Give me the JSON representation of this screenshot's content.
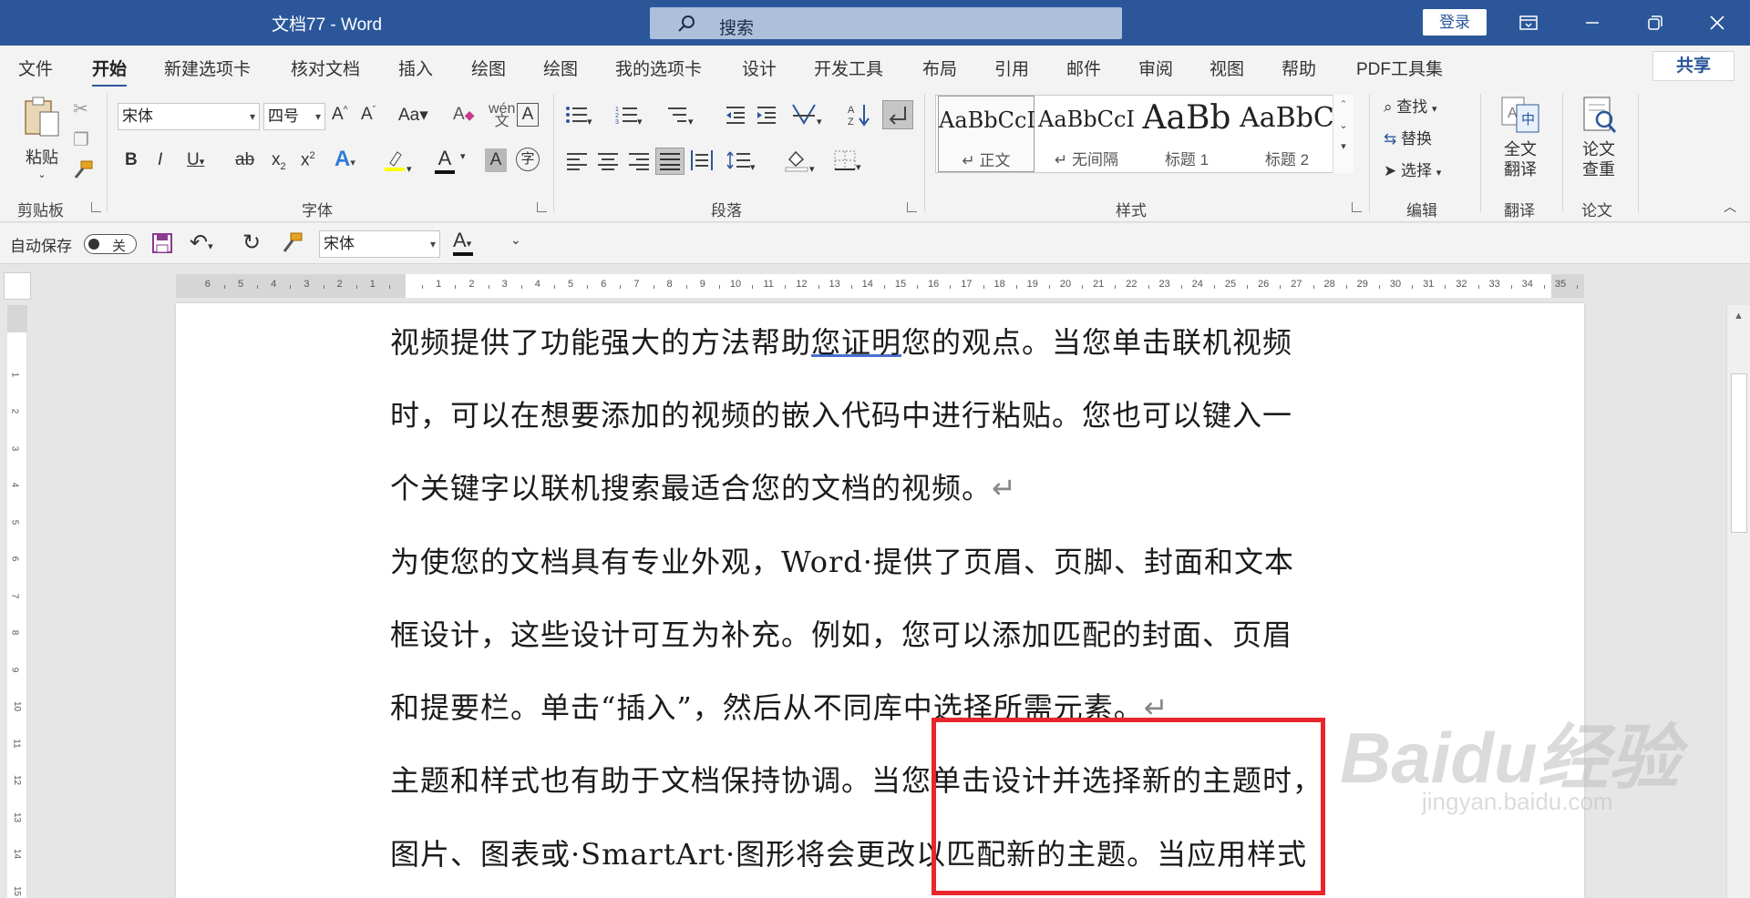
{
  "titlebar": {
    "title": "文档77  -  Word",
    "search_placeholder": "搜索",
    "login": "登录"
  },
  "tabs": {
    "file": "文件",
    "home": "开始",
    "new_tab": "新建选项卡",
    "proof": "核对文档",
    "insert": "插入",
    "draw1": "绘图",
    "draw2": "绘图",
    "mytab": "我的选项卡",
    "design": "设计",
    "developer": "开发工具",
    "layout": "布局",
    "references": "引用",
    "mailings": "邮件",
    "review": "审阅",
    "view": "视图",
    "help": "帮助",
    "pdf": "PDF工具集",
    "share": "共享"
  },
  "ribbon": {
    "clipboard": {
      "paste": "粘贴",
      "label": "剪贴板"
    },
    "font": {
      "name": "宋体",
      "size": "四号",
      "label": "字体"
    },
    "paragraph": {
      "label": "段落"
    },
    "styles": {
      "label": "样式",
      "items": [
        {
          "sample": "AaBbCcI",
          "name": "↵ 正文"
        },
        {
          "sample": "AaBbCcI",
          "name": "↵ 无间隔"
        },
        {
          "sample": "AaBb",
          "name": "标题 1"
        },
        {
          "sample": "AaBbC",
          "name": "标题 2"
        }
      ]
    },
    "editing": {
      "find": "查找",
      "replace": "替换",
      "select": "选择",
      "label": "编辑"
    },
    "translate": {
      "full": "全文",
      "translate": "翻译",
      "label": "翻译"
    },
    "paper": {
      "line1": "论文",
      "line2": "查重",
      "label": "论文"
    }
  },
  "qat": {
    "autosave": "自动保存",
    "toggle_off": "关",
    "font": "宋体"
  },
  "document": {
    "p1": [
      "视频提供了功能强大的方法帮助",
      "您证明",
      "您的观点。当您单击联机视频",
      "时，可以在想要添加的视频的嵌入代码中进行粘贴。您也可以键入一",
      "个关键字以联机搜索最适合您的文档的视频。"
    ],
    "p2": [
      "为使您的文档具有专业外观，Word·提供了页眉、页脚、封面和文本",
      "框设计，这些设计可互为补充。例如，您可以添加匹配的封面、页眉",
      "和提要栏。单击“插入”，然后从不同库中选择所需元素。"
    ],
    "p3": [
      "主题和样式也有助于文档保持协调。当您单击设计并选择新的主题时，",
      "图片、图表或·SmartArt·图形将会更改以匹配新的主题。当应用样式"
    ],
    "para_mark": "↵"
  },
  "watermark": {
    "logo": "Baidu经验",
    "url": "jingyan.baidu.com"
  },
  "colors": {
    "title_bar": "#2b579a",
    "annotation": "#e8262b"
  }
}
